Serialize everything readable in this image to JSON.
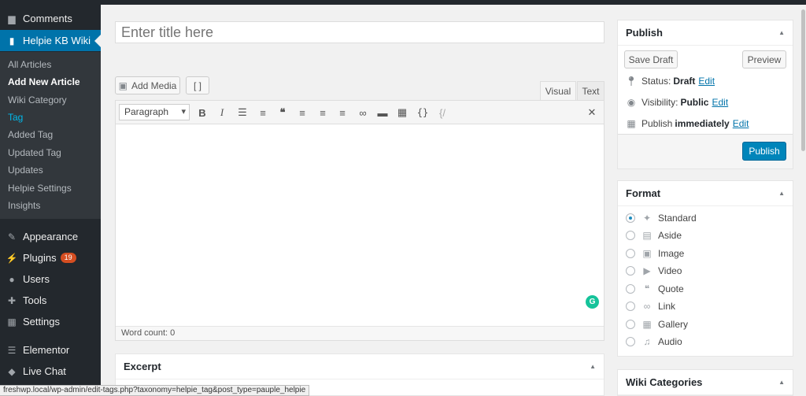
{
  "sidebar": {
    "comments": "Comments",
    "helpie_kb_wiki": "Helpie KB Wiki",
    "submenu": [
      "All Articles",
      "Add New Article",
      "Wiki Category",
      "Tag",
      "Added Tag",
      "Updated Tag",
      "Updates",
      "Helpie Settings",
      "Insights"
    ],
    "appearance": "Appearance",
    "plugins": "Plugins",
    "plugins_badge": "19",
    "users": "Users",
    "tools": "Tools",
    "settings": "Settings",
    "elementor": "Elementor",
    "live_chat": "Live Chat"
  },
  "editor": {
    "title_placeholder": "Enter title here",
    "add_media": "Add Media",
    "shortcode_button": "[ ]",
    "tab_visual": "Visual",
    "tab_text": "Text",
    "format_select": "Paragraph",
    "word_count": "Word count: 0"
  },
  "publish": {
    "title": "Publish",
    "save_draft": "Save Draft",
    "preview": "Preview",
    "status_label": "Status:",
    "status_value": "Draft",
    "visibility_label": "Visibility:",
    "visibility_value": "Public",
    "publish_label": "Publish",
    "publish_value": "immediately",
    "edit": "Edit",
    "publish_button": "Publish"
  },
  "format": {
    "title": "Format",
    "options": [
      "Standard",
      "Aside",
      "Image",
      "Video",
      "Quote",
      "Link",
      "Gallery",
      "Audio"
    ],
    "selected": "Standard"
  },
  "excerpt": {
    "title": "Excerpt"
  },
  "wiki_categories": {
    "title": "Wiki Categories"
  },
  "status_url": "freshwp.local/wp-admin/edit-tags.php?taxonomy=helpie_tag&post_type=pauple_helpie",
  "colors": {
    "sidebar": "#23282d",
    "accent": "#0073aa",
    "publish_button": "#0085ba",
    "badge": "#d54e21"
  }
}
